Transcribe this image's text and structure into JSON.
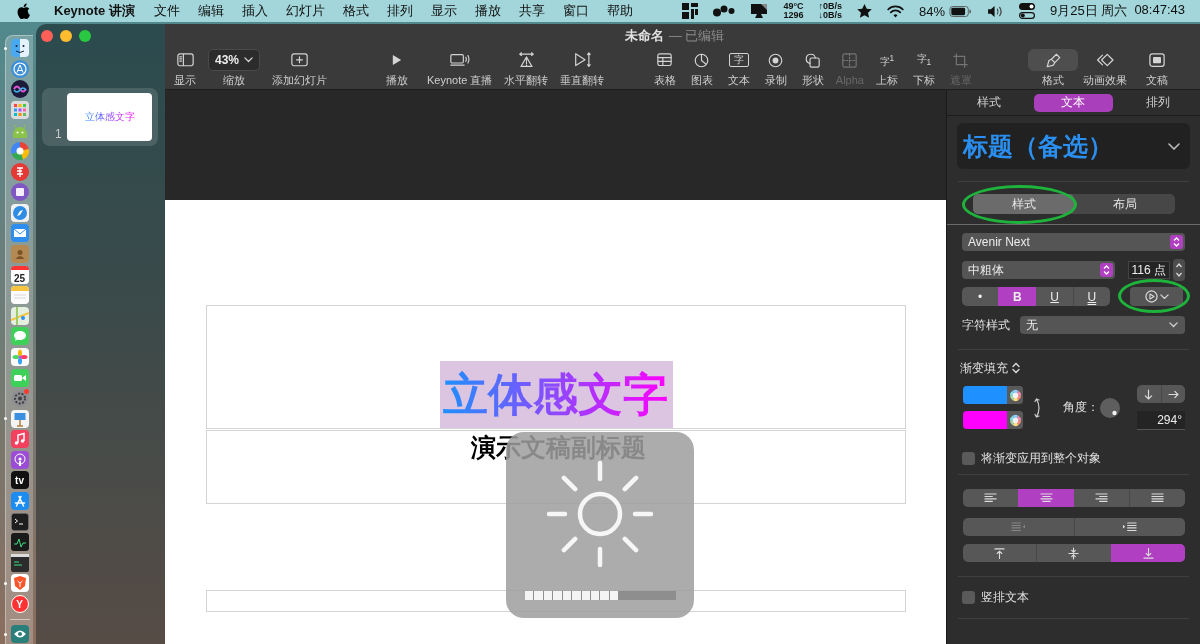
{
  "menu_bar": {
    "app_name": "Keynote 讲演",
    "menus": [
      "文件",
      "编辑",
      "插入",
      "幻灯片",
      "格式",
      "排列",
      "显示",
      "播放",
      "共享",
      "窗口",
      "帮助"
    ],
    "cpu_temperature": "49°C",
    "fan_speed": "1296",
    "upload_speed": "↑0B/s",
    "download_speed": "↓0B/s",
    "battery_percent": "84%",
    "date": "9月25日 周六",
    "time": "08:47:43"
  },
  "dock": {
    "items": [
      {
        "running": true
      },
      {
        "running": false
      },
      {
        "running": false
      },
      {
        "running": false
      },
      {
        "running": false
      },
      {
        "running": false
      },
      {
        "running": false
      },
      {
        "running": false
      },
      {
        "running": false
      },
      {
        "running": false
      },
      {
        "running": false
      },
      {
        "running": false,
        "label": "25"
      },
      {
        "running": false
      },
      {
        "running": false
      },
      {
        "running": false
      },
      {
        "running": false
      },
      {
        "running": false
      },
      {
        "running": false
      },
      {
        "running": true
      },
      {
        "running": false
      },
      {
        "running": false
      },
      {
        "running": false,
        "label": "tv"
      },
      {
        "running": false
      },
      {
        "running": false
      },
      {
        "running": false
      },
      {
        "running": false
      },
      {
        "running": true
      },
      {
        "running": false,
        "label": "Y"
      },
      {
        "running": true
      }
    ]
  },
  "window": {
    "title": "未命名",
    "edited_note": "— 已编辑"
  },
  "toolbar": {
    "groups": [
      {
        "items": [
          {
            "kind": "sidebar",
            "label": "显示",
            "disabled": false
          },
          {
            "kind": "zoom",
            "label": "缩放",
            "value": "43%",
            "disabled": false
          },
          {
            "kind": "add_slide",
            "label": "添加幻灯片",
            "disabled": false
          }
        ]
      },
      {
        "items": [
          {
            "kind": "play",
            "label": "播放",
            "disabled": false
          },
          {
            "kind": "live",
            "label": "Keynote 直播",
            "disabled": false
          },
          {
            "kind": "flip_horizontal",
            "label": "水平翻转",
            "disabled": false
          },
          {
            "kind": "flip_vertical",
            "label": "垂直翻转",
            "disabled": false
          }
        ]
      },
      {
        "items": [
          {
            "kind": "table",
            "label": "表格",
            "disabled": false
          },
          {
            "kind": "chart",
            "label": "图表",
            "disabled": false
          },
          {
            "kind": "text",
            "label": "文本",
            "glyph": "字",
            "disabled": false
          },
          {
            "kind": "record",
            "label": "录制",
            "disabled": false
          },
          {
            "kind": "shape",
            "label": "形状",
            "disabled": false
          },
          {
            "kind": "alpha",
            "label": "Alpha",
            "disabled": true
          },
          {
            "kind": "superscript",
            "label": "上标",
            "glyph": "字$^{1}$",
            "disabled": false
          },
          {
            "kind": "subscript",
            "label": "下标",
            "glyph": "字$_{1}$",
            "disabled": false
          },
          {
            "kind": "mask",
            "label": "遮罩",
            "disabled": true
          }
        ]
      },
      {
        "items": [
          {
            "kind": "format",
            "label": "格式",
            "disabled": false,
            "selected": true
          },
          {
            "kind": "animate",
            "label": "动画效果",
            "disabled": false,
            "selected": false
          },
          {
            "kind": "document",
            "label": "文稿",
            "disabled": false,
            "selected": false
          }
        ]
      }
    ]
  },
  "navigator": {
    "slides": [
      {
        "number": "1",
        "title": "立体感文字",
        "selected": true
      }
    ]
  },
  "slide": {
    "title": "立体感文字",
    "title_selected": true,
    "subtitle": "演示文稿副标题"
  },
  "brightness_hud": {
    "level": 0.625
  },
  "inspector": {
    "tabs": [
      {
        "label": "样式",
        "selected": false
      },
      {
        "label": "文本",
        "selected": true
      },
      {
        "label": "排列",
        "selected": false
      }
    ],
    "paragraph_style": "标题（备选）",
    "text_tabs": [
      {
        "label": "样式",
        "selected": true,
        "circled": true
      },
      {
        "label": "布局",
        "selected": false,
        "circled": false
      }
    ],
    "font_family": "Avenir Next",
    "typeface": "中粗体",
    "font_size": "116 点",
    "format_buttons": [
      {
        "kind": "dot",
        "label": "•",
        "selected": false
      },
      {
        "kind": "bold",
        "label": "B",
        "selected": true
      },
      {
        "kind": "underline",
        "label": "U",
        "selected": false
      },
      {
        "kind": "double_underline",
        "label": "U",
        "selected": false
      }
    ],
    "options_button": {
      "circled": true
    },
    "character_style": {
      "label": "字符样式",
      "value": "无"
    },
    "fill": {
      "label": "渐变填充",
      "colors": [
        {
          "color": "#1e90ff"
        },
        {
          "color": "#ff00ff"
        }
      ],
      "angle_label": "角度：",
      "angle": "294°"
    },
    "apply_to_object": {
      "label": "将渐变应用到整个对象",
      "checked": false
    },
    "alignment": [
      {
        "kind": "left",
        "selected": false
      },
      {
        "kind": "center",
        "selected": true
      },
      {
        "kind": "right",
        "selected": false
      },
      {
        "kind": "justify",
        "selected": false
      }
    ],
    "indent": [
      {
        "kind": "decrease",
        "disabled": true
      },
      {
        "kind": "increase",
        "disabled": false
      }
    ],
    "vertical_alignment": [
      {
        "kind": "top",
        "selected": false
      },
      {
        "kind": "middle",
        "selected": false
      },
      {
        "kind": "bottom",
        "selected": true
      }
    ],
    "vertical_text": {
      "label": "竖排文本",
      "checked": false
    }
  }
}
